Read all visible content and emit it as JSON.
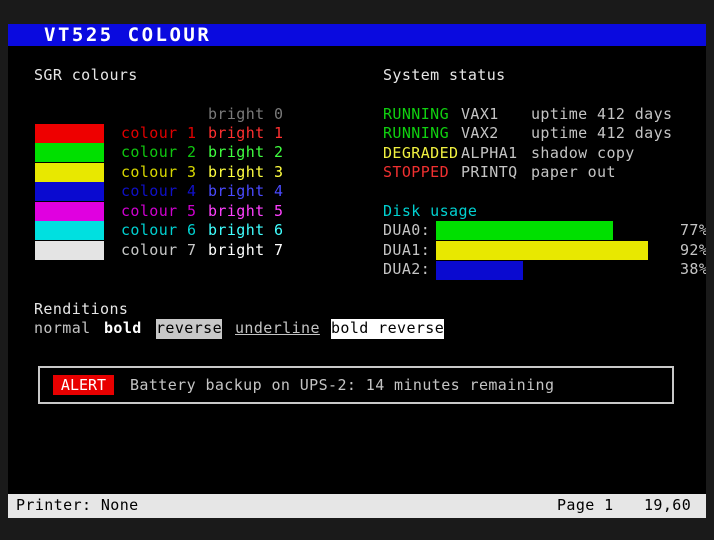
{
  "window": {
    "title": "VT525 COLOUR"
  },
  "sgr": {
    "heading": "SGR colours",
    "bright0": "bright 0",
    "rows": [
      {
        "normal_label": "colour 1",
        "bright_label": "bright 1",
        "normal_color": "#e00000",
        "bright_color": "#ff3030",
        "swatch": "#ee0000"
      },
      {
        "normal_label": "colour 2",
        "bright_label": "bright 2",
        "normal_color": "#10c810",
        "bright_color": "#40ff40",
        "swatch": "#00e000"
      },
      {
        "normal_label": "colour 3",
        "bright_label": "bright 3",
        "normal_color": "#d8d800",
        "bright_color": "#ffff40",
        "swatch": "#e8e800"
      },
      {
        "normal_label": "colour 4",
        "bright_label": "bright 4",
        "normal_color": "#1010c8",
        "bright_color": "#4a4aff",
        "swatch": "#0a0ad0"
      },
      {
        "normal_label": "colour 5",
        "bright_label": "bright 5",
        "normal_color": "#d000d0",
        "bright_color": "#ff40ff",
        "swatch": "#e000e0"
      },
      {
        "normal_label": "colour 6",
        "bright_label": "bright 6",
        "normal_color": "#00d0d0",
        "bright_color": "#40ffff",
        "swatch": "#00e0e0"
      },
      {
        "normal_label": "colour 7",
        "bright_label": "bright 7",
        "normal_color": "#c8c8c8",
        "bright_color": "#ffffff",
        "swatch": "#e4e4e4"
      }
    ]
  },
  "renditions": {
    "heading": "Renditions",
    "normal": "normal",
    "bold": "bold",
    "reverse": "reverse",
    "underline": "underline",
    "bold_reverse": "bold reverse"
  },
  "system_status": {
    "heading": "System status",
    "rows": [
      {
        "state": "RUNNING",
        "host": "VAX1",
        "detail": "uptime 412 days",
        "state_color": "#10d010"
      },
      {
        "state": "RUNNING",
        "host": "VAX2",
        "detail": "uptime 412 days",
        "state_color": "#10d010"
      },
      {
        "state": "DEGRADED",
        "host": "ALPHA1",
        "detail": "shadow copy",
        "state_color": "#f0f040"
      },
      {
        "state": "STOPPED",
        "host": "PRINTQ",
        "detail": "paper out",
        "state_color": "#f03030"
      }
    ]
  },
  "disk_usage": {
    "heading": "Disk usage",
    "disks": [
      {
        "name": "DUA0:",
        "percent_label": "77%",
        "fraction": 0.77,
        "color": "#00e000"
      },
      {
        "name": "DUA1:",
        "percent_label": "92%",
        "fraction": 0.92,
        "color": "#e8e800"
      },
      {
        "name": "DUA2:",
        "percent_label": "38%",
        "fraction": 0.38,
        "color": "#0a0ad0"
      }
    ]
  },
  "alert": {
    "label": "ALERT",
    "message": "Battery backup on UPS-2: 14 minutes remaining"
  },
  "status_bar": {
    "printer": "Printer: None",
    "page": "Page 1",
    "position": "19,60"
  }
}
